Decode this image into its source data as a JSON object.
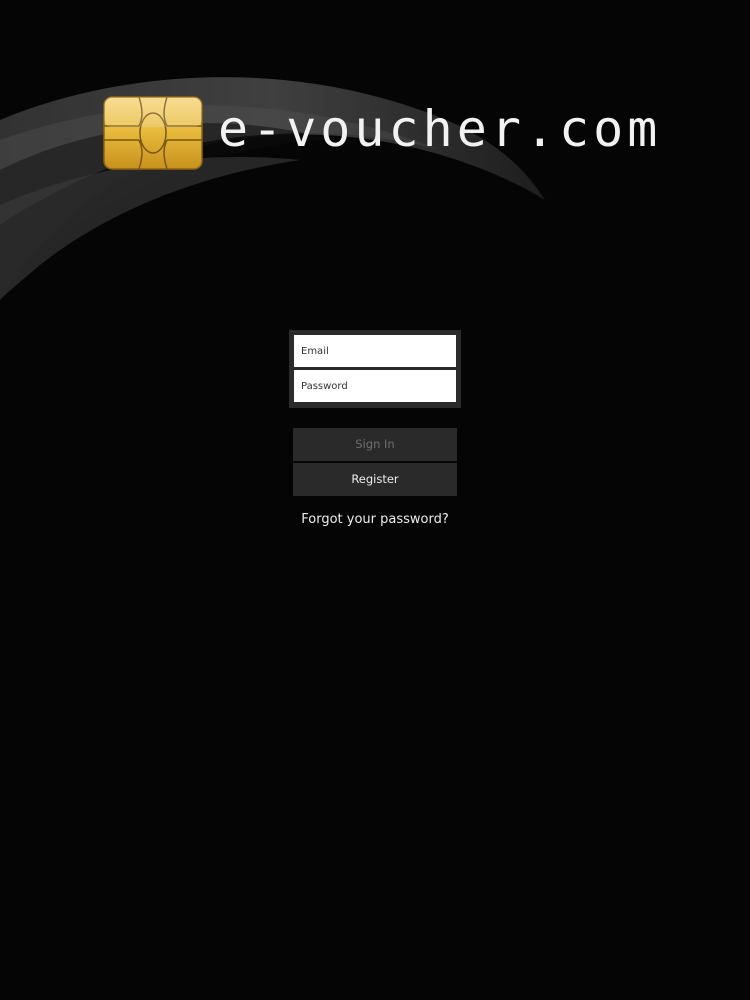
{
  "brand": {
    "name": "e-voucher.com",
    "logo_icon": "smart-card-chip-icon"
  },
  "login": {
    "email_placeholder": "Email",
    "email_value": "",
    "password_placeholder": "Password",
    "password_value": ""
  },
  "actions": {
    "sign_in_label": "Sign In",
    "register_label": "Register",
    "forgot_password_label": "Forgot your password?"
  },
  "colors": {
    "background": "#050505",
    "button_background": "#2a2a2a",
    "disabled_text": "#6e6e6e",
    "chip_gold": "#e6b93a"
  }
}
